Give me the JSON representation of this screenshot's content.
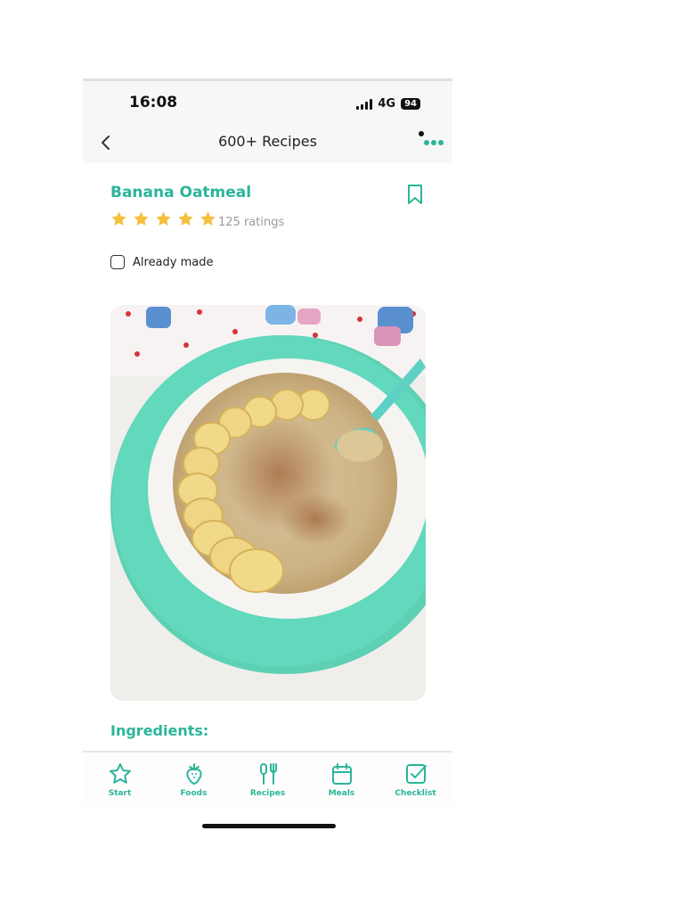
{
  "status_bar": {
    "time": "16:08",
    "network": "4G",
    "battery": "94"
  },
  "nav": {
    "title": "600+ Recipes",
    "back_icon": "chevron-left-icon",
    "more_icon": "more-dots-icon"
  },
  "recipe": {
    "title": "Banana Oatmeal",
    "rating_stars": 5,
    "ratings_text": "125 ratings",
    "already_made_label": "Already made",
    "already_made_checked": false,
    "ingredients_heading": "Ingredients:"
  },
  "colors": {
    "accent": "#2bb59a",
    "star": "#f6bf3c",
    "muted": "#9a9a9a"
  },
  "tabs": [
    {
      "label": "Start",
      "icon": "star-icon"
    },
    {
      "label": "Foods",
      "icon": "strawberry-icon"
    },
    {
      "label": "Recipes",
      "icon": "utensils-icon"
    },
    {
      "label": "Meals",
      "icon": "calendar-icon"
    },
    {
      "label": "Checklist",
      "icon": "checkbox-icon"
    }
  ]
}
